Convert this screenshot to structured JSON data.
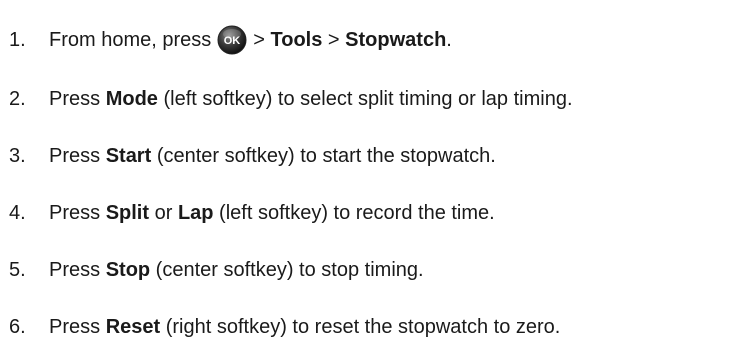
{
  "steps": [
    {
      "number": "1.",
      "t1": "From home, press",
      "icon": "ok-button-icon",
      "icon_label": "OK",
      "sep1": "> ",
      "b1": "Tools",
      "sep2": " > ",
      "b2": "Stopwatch",
      "end": "."
    },
    {
      "number": "2.",
      "t1": "Press ",
      "b1": "Mode",
      "t2": " (left softkey) to select split timing or lap timing."
    },
    {
      "number": "3.",
      "t1": "Press ",
      "b1": "Start",
      "t2": " (center softkey) to start the stopwatch."
    },
    {
      "number": "4.",
      "t1": "Press ",
      "b1": "Split",
      "t2": " or ",
      "b2": "Lap",
      "t3": " (left softkey) to record the time."
    },
    {
      "number": "5.",
      "t1": "Press ",
      "b1": "Stop",
      "t2": " (center softkey) to stop timing."
    },
    {
      "number": "6.",
      "t1": "Press ",
      "b1": "Reset",
      "t2": " (right softkey) to reset the stopwatch to zero."
    }
  ]
}
